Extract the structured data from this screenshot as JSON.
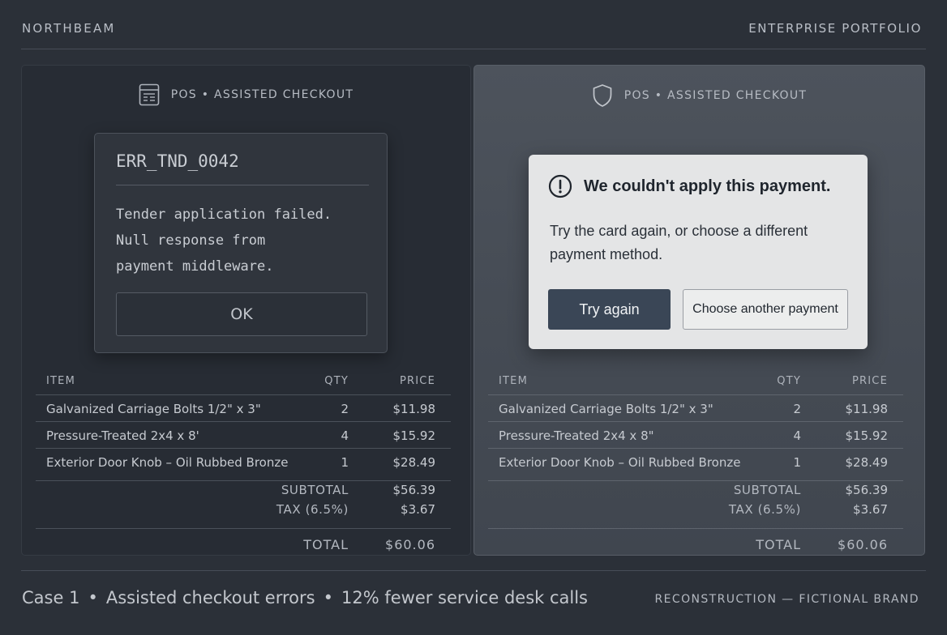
{
  "header": {
    "brand": "NORTHBEAM",
    "portfolio": "ENTERPRISE PORTFOLIO"
  },
  "colors": {
    "background": "#2b3038",
    "primary_button": "#3a4656",
    "modern_dialog": "#e4e5e6"
  },
  "left_panel": {
    "label": "POS • ASSISTED CHECKOUT",
    "icon": "receipt-terminal-icon",
    "dialog": {
      "code": "ERR_TND_0042",
      "lines": [
        "Tender application failed.",
        "Null response from",
        "payment middleware."
      ],
      "ok_label": "OK"
    }
  },
  "right_panel": {
    "label": "POS • ASSISTED CHECKOUT",
    "icon": "shield-icon",
    "dialog": {
      "icon": "alert-circle-icon",
      "title": "We couldn't apply this payment.",
      "body": "Try the card again, or choose a different payment method.",
      "primary_label": "Try again",
      "secondary_label": "Choose another payment"
    }
  },
  "order_left": {
    "headers": {
      "item": "ITEM",
      "qty": "QTY",
      "price": "PRICE"
    },
    "items": [
      {
        "name": "Galvanized Carriage Bolts 1/2\" x 3\"",
        "qty": "2",
        "price": "$11.98"
      },
      {
        "name": "Pressure-Treated 2x4 x 8'",
        "qty": "4",
        "price": "$15.92"
      },
      {
        "name": "Exterior Door Knob – Oil Rubbed Bronze",
        "qty": "1",
        "price": "$28.49"
      }
    ],
    "subtotal_label": "SUBTOTAL",
    "subtotal": "$56.39",
    "tax_label": "TAX (6.5%)",
    "tax": "$3.67",
    "total_label": "TOTAL",
    "total": "$60.06"
  },
  "order_right": {
    "headers": {
      "item": "ITEM",
      "qty": "QTY",
      "price": "PRICE"
    },
    "items": [
      {
        "name": "Galvanized Carriage Bolts 1/2\" x 3\"",
        "qty": "2",
        "price": "$11.98"
      },
      {
        "name": "Pressure-Treated 2x4 x 8\"",
        "qty": "4",
        "price": "$15.92"
      },
      {
        "name": "Exterior Door Knob – Oil Rubbed Bronze",
        "qty": "1",
        "price": "$28.49"
      }
    ],
    "subtotal_label": "SUBTOTAL",
    "subtotal": "$56.39",
    "tax_label": "TAX (6.5%)",
    "tax": "$3.67",
    "total_label": "TOTAL",
    "total": "$60.06"
  },
  "footer": {
    "case": "Case 1",
    "topic": "Assisted checkout errors",
    "result": "12% fewer service desk calls",
    "separator": "•",
    "note": "RECONSTRUCTION — FICTIONAL BRAND"
  }
}
